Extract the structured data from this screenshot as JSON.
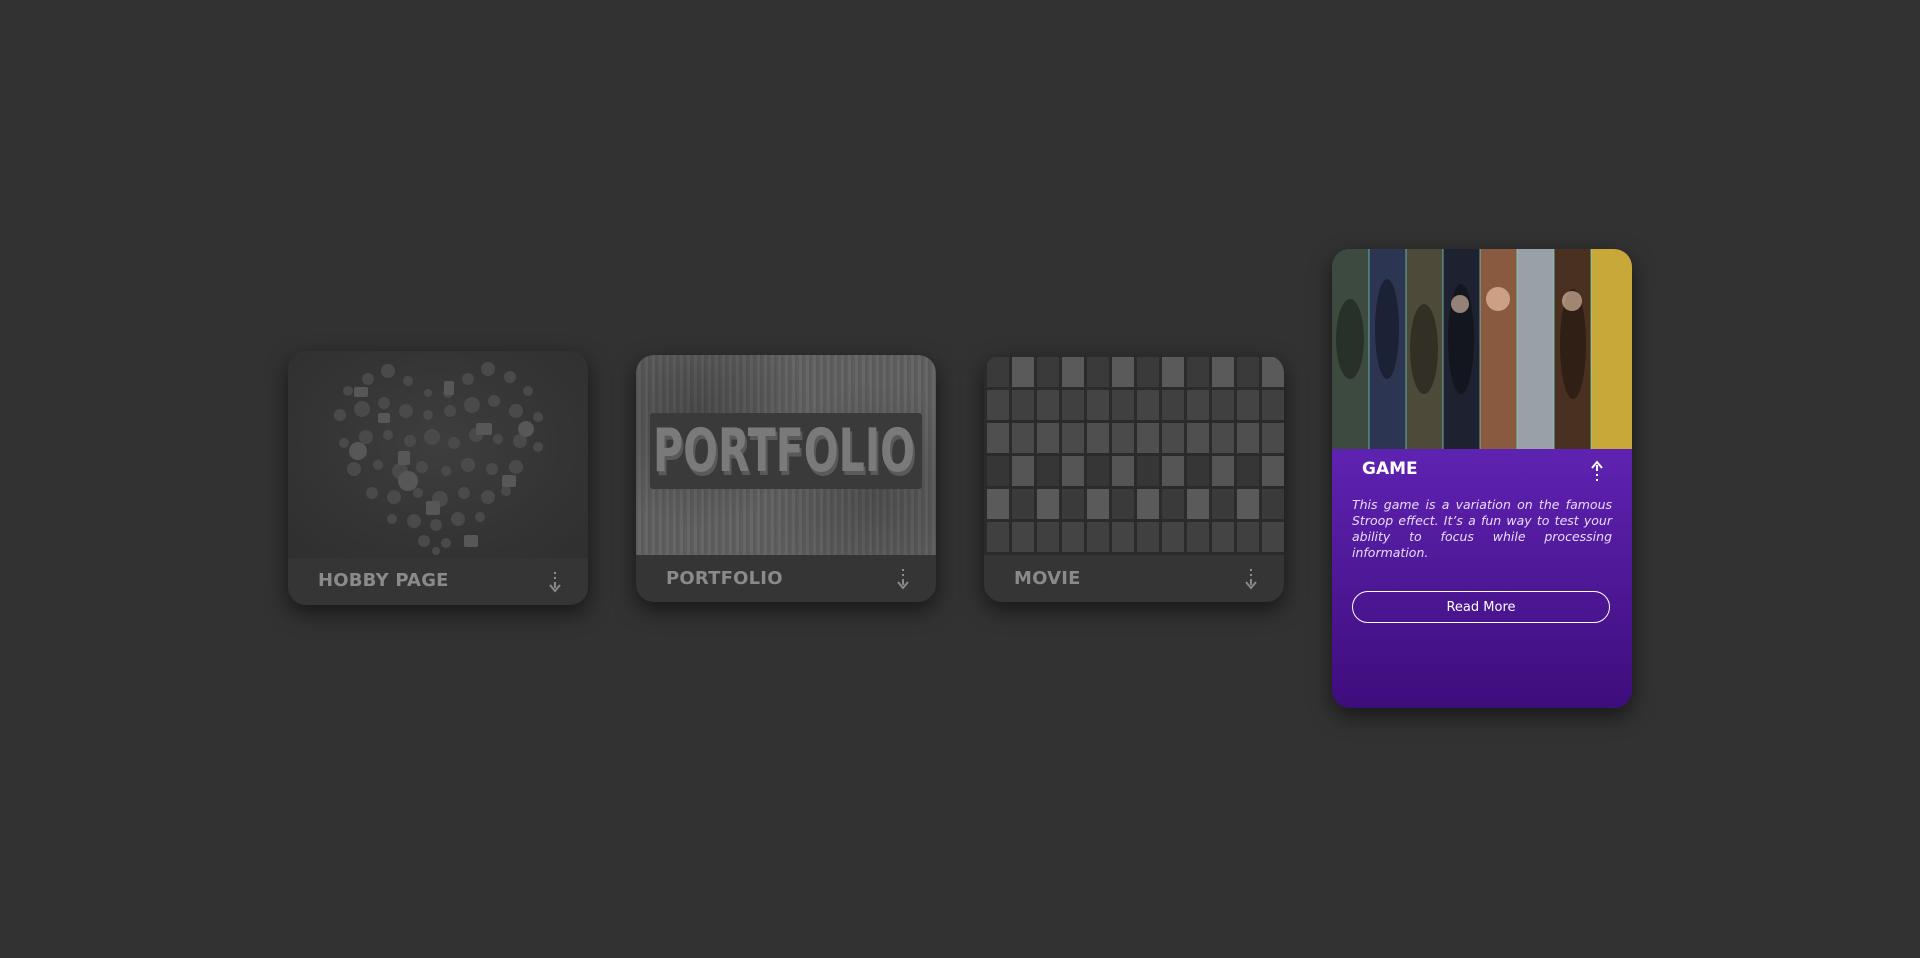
{
  "cards": [
    {
      "label": "HOBBY PAGE",
      "arrow": "arrow-down-icon",
      "state": "collapsed"
    },
    {
      "label": "PORTFOLIO",
      "thumb_text": "PORTFOLIO",
      "arrow": "arrow-down-icon",
      "state": "collapsed"
    },
    {
      "label": "MOVIE",
      "arrow": "arrow-down-icon",
      "state": "collapsed"
    },
    {
      "label": "GAME",
      "arrow": "arrow-up-icon",
      "state": "expanded",
      "description": "This game is a variation on the famous Stroop effect. It’s a fun way to test your ability to focus while processing information.",
      "button_label": "Read More"
    }
  ],
  "colors": {
    "background": "#323232",
    "card_inactive": "#353535",
    "label_inactive": "#8a8a8a",
    "game_gradient_top": "#7430c7",
    "game_gradient_bottom": "#3e0d7c",
    "white": "#ffffff"
  }
}
